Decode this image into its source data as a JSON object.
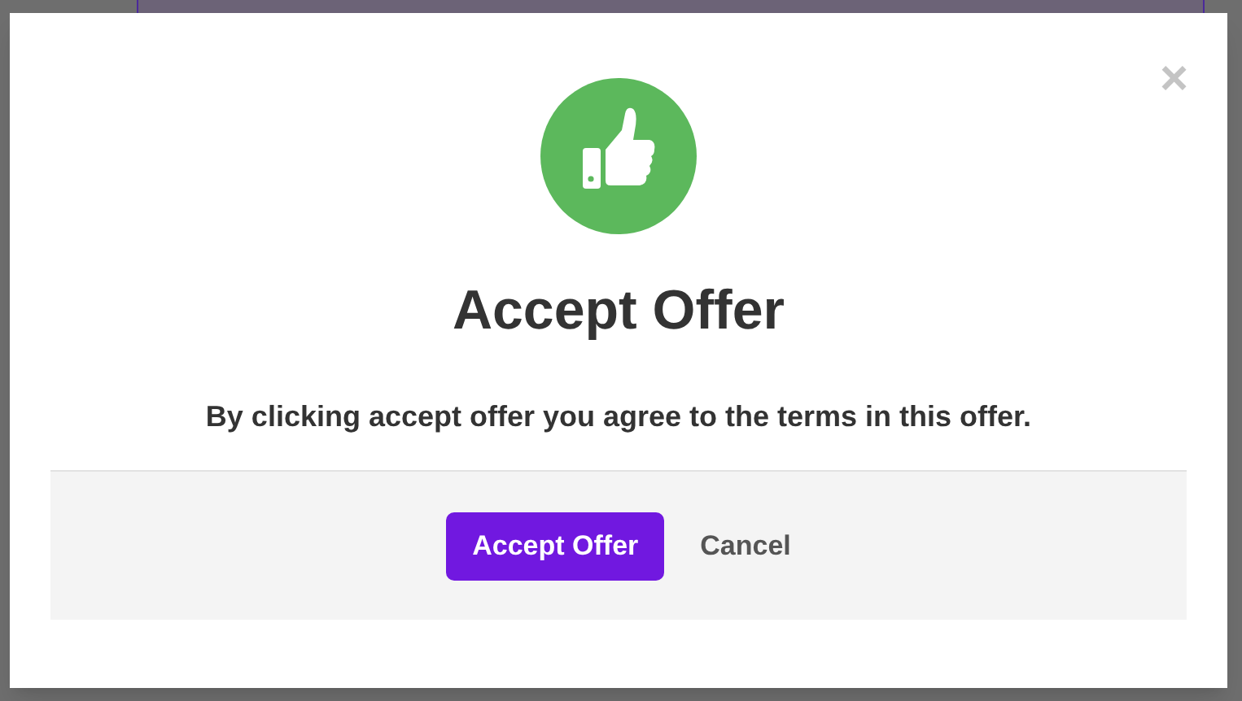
{
  "dialog": {
    "close": "×",
    "title": "Accept Offer",
    "message": "By clicking accept offer you agree to the terms in this offer.",
    "buttons": [
      {
        "label": "Accept Offer",
        "kind": "primary"
      },
      {
        "label": "Cancel",
        "kind": "link"
      }
    ]
  }
}
